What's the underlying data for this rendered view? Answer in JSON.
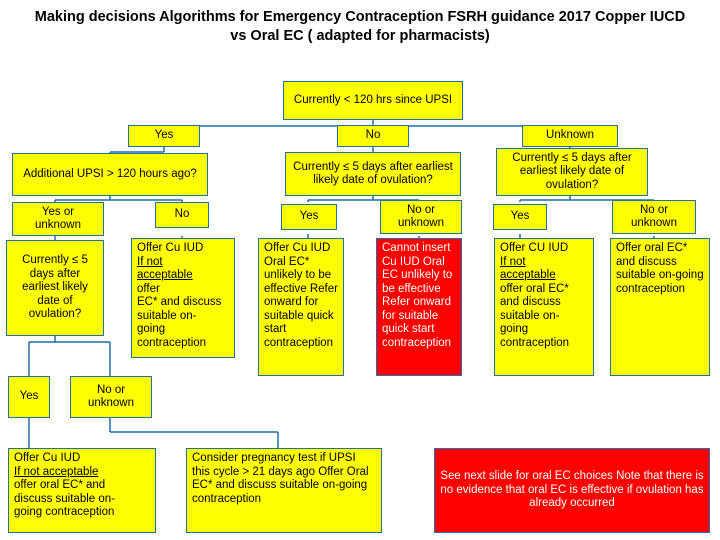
{
  "title": "Making decisions Algorithms  for Emergency Contraception FSRH guidance 2017 Copper IUCD vs Oral EC ( adapted for pharmacists)",
  "colors": {
    "node_fill": "#ffff00",
    "node_border": "#1f6fa8",
    "alert_fill": "#ff0000",
    "alert_text": "#ffffff",
    "text": "#000000"
  },
  "nodes": {
    "root": "Currently < 120 hrs since UPSI",
    "branch_yes": "Yes",
    "branch_no": "No",
    "branch_unknown": "Unknown",
    "additional_upsi": "Additional UPSI > 120 hours ago?",
    "yes_or_unknown_1": "Yes or unknown",
    "no_1": "No",
    "currently_5days_mid": "Currently ≤ 5 days  after earliest likely date of ovulation?",
    "yes_mid": "Yes",
    "no_or_unknown_mid": "No or unknown",
    "currently_5days_right": "Currently ≤ 5 days after earliest likely date of ovulation?",
    "yes_right": "Yes",
    "no_or_unknown_right": "No or unknown",
    "currently_5days_left": "Currently ≤ 5 days after earliest likely date of ovulation?",
    "offer_cu_iud_col2": "Offer Cu IUD If not acceptable offer EC* and discuss suitable on-going contraception",
    "offer_cu_iud_col2_lines": [
      "Offer Cu IUD",
      "If not",
      "acceptable",
      " offer",
      "EC* and discuss",
      "suitable on-",
      "going",
      "contraception"
    ],
    "offer_cu_iud_mid": "Offer Cu IUD Oral EC* unlikely to be effective Refer onward for suitable quick start contraception",
    "cannot_insert": "Cannot insert Cu IUD Oral EC unlikely to be effective Refer onward for  suitable quick start contraception",
    "offer_cu_iud_right": "Offer CU IUD If not acceptable offer oral EC* and discuss suitable on-going contraception",
    "offer_oral_ec_right": "Offer oral EC* and discuss suitable on-going contraception",
    "yes_left_lower": "Yes",
    "no_or_unknown_left_lower": "No or unknown",
    "offer_cu_iud_bottom": "Offer Cu IUD If not acceptable offer oral EC* and discuss suitable on-going contraception",
    "consider_pregnancy": "Consider pregnancy test if UPSI this cycle > 21 days ago Offer Oral EC* and discuss suitable on-going contraception",
    "see_next_slide": "See next slide for oral EC choices Note that there is no evidence that oral EC is effective if ovulation has already occurred"
  },
  "node_text_parts": {
    "offer_cu_iud_col2": {
      "l1": "Offer Cu IUD",
      "l2": "If not",
      "l3": "acceptable",
      "l4": " offer",
      "l5": "EC* and discuss",
      "l6": "suitable on-",
      "l7": "going",
      "l8": "contraception"
    },
    "offer_cu_iud_right": {
      "l1": "Offer CU IUD",
      "l2": "If not",
      "l3": "acceptable",
      "l4": "offer oral EC*",
      "l5": "and discuss",
      "l6": "suitable on-",
      "l7": "going",
      "l8": "contraception"
    },
    "offer_cu_iud_bottom": {
      "l1": "Offer Cu IUD",
      "l2": "If not acceptable",
      "l3": "offer oral EC* and",
      "l4": "discuss suitable on-",
      "l5": "going contraception"
    }
  }
}
